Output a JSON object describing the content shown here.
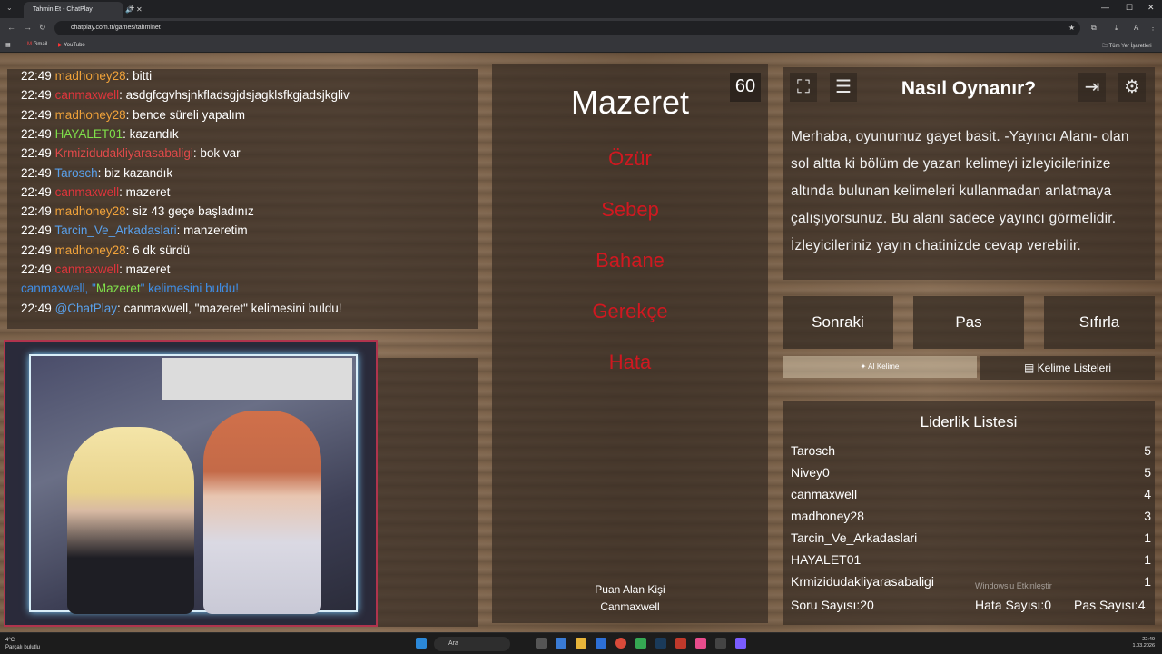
{
  "browser": {
    "tab_title": "Tahmin Et - ChatPlay",
    "url": "chatplay.com.tr/games/tahminet",
    "bookmarks": [
      "Gmail",
      "YouTube"
    ],
    "bookmarks_right": "Tüm Yer İşaretleri"
  },
  "chat": {
    "lines": [
      {
        "time": "22:49",
        "user": "madhoney28",
        "sep": ": ",
        "msg": "bitti",
        "color": "#f0a23a"
      },
      {
        "time": "22:49",
        "user": "canmaxwell",
        "sep": ": ",
        "msg": "asdgfcgvhsjnkfladsgjdsjagklsfkgjadsjkgliv",
        "color": "#e0353c"
      },
      {
        "time": "22:49",
        "user": "madhoney28",
        "sep": ": ",
        "msg": "bence süreli yapalım",
        "color": "#f0a23a"
      },
      {
        "time": "22:49",
        "user": "HAYALET01",
        "sep": ": ",
        "msg": "kazandık",
        "color": "#7fe04a"
      },
      {
        "time": "22:49",
        "user": "Krmizidudakliyarasabaligi",
        "sep": ": ",
        "msg": "bok var",
        "color": "#e04a4a"
      },
      {
        "time": "22:49",
        "user": "Tarosch",
        "sep": ": ",
        "msg": "biz kazandık",
        "color": "#5aa0ea"
      },
      {
        "time": "22:49",
        "user": "canmaxwell",
        "sep": ": ",
        "msg": "mazeret",
        "color": "#e0353c"
      },
      {
        "time": "22:49",
        "user": "madhoney28",
        "sep": ": ",
        "msg": "siz 43 geçe başladınız",
        "color": "#f0a23a"
      },
      {
        "time": "22:49",
        "user": "Tarcin_Ve_Arkadaslari",
        "sep": ": ",
        "msg": "manzeretim",
        "color": "#5aa0ea"
      },
      {
        "time": "22:49",
        "user": "madhoney28",
        "sep": ": ",
        "msg": "6 dk sürdü",
        "color": "#f0a23a"
      },
      {
        "time": "22:49",
        "user": "canmaxwell",
        "sep": ": ",
        "msg": "mazeret",
        "color": "#e0353c"
      }
    ],
    "found_pre": "canmaxwell, \"",
    "found_word": "Mazeret",
    "found_post": "\" kelimesini buldu!",
    "last_time": "22:49",
    "last_user": "@ChatPlay",
    "last_msg": ": canmaxwell, \"mazeret\" kelimesini buldu!"
  },
  "word_card": {
    "word": "Mazeret",
    "timer": "60",
    "taboo": [
      "Özür",
      "Sebep",
      "Bahane",
      "Gerekçe",
      "Hata"
    ],
    "scorer_label": "Puan Alan Kişi",
    "scorer_name": "Canmaxwell"
  },
  "howto": {
    "title": "Nasıl Oynanır?",
    "text": "Merhaba, oyunumuz gayet basit. -Yayıncı Alanı- olan sol altta ki bölüm de yazan kelimeyi izleyicilerinize altında bulunan kelimeleri kullanmadan anlatmaya çalışıyorsunuz. Bu alanı sadece yayıncı görmelidir. İzleyicileriniz yayın chatinizde cevap verebilir."
  },
  "controls": {
    "next": "Sonraki",
    "pass": "Pas",
    "reset": "Sıfırla",
    "ai_word": "AI Kelime",
    "word_lists": "Kelime Listeleri"
  },
  "leaderboard": {
    "title": "Liderlik Listesi",
    "rows": [
      {
        "name": "Tarosch",
        "score": "5"
      },
      {
        "name": "Nivey0",
        "score": "5"
      },
      {
        "name": "canmaxwell",
        "score": "4"
      },
      {
        "name": "madhoney28",
        "score": "3"
      },
      {
        "name": "Tarcin_Ve_Arkadaslari",
        "score": "1"
      },
      {
        "name": "HAYALET01",
        "score": "1"
      },
      {
        "name": "Krmizidudakliyarasabaligi",
        "score": "1"
      }
    ],
    "question_count": "Soru Sayısı:20",
    "error_count": "Hata Sayısı:0",
    "pass_count": "Pas Sayısı:4",
    "watermark": "Windows'u Etkinleştir"
  },
  "taskbar": {
    "weather_temp": "4°C",
    "weather_desc": "Parçalı bulutlu",
    "search": "Ara",
    "time": "22:49",
    "date": "1.03.2026"
  }
}
